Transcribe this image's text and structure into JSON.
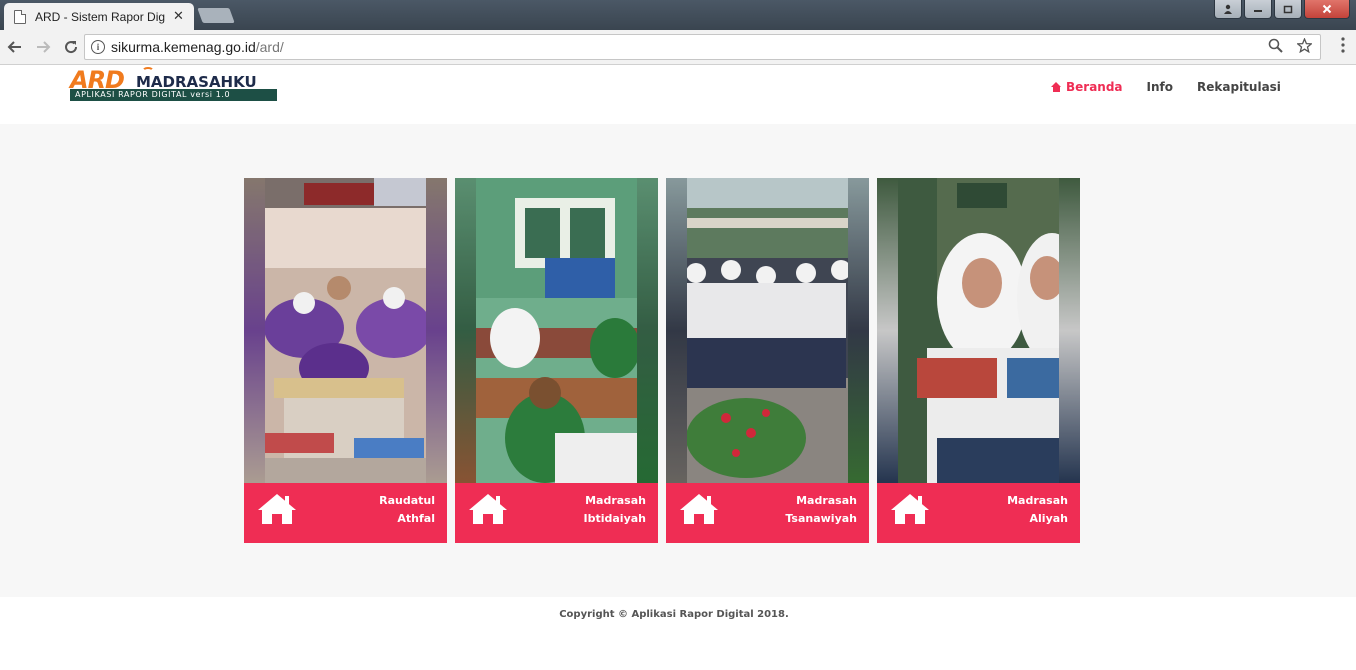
{
  "browser": {
    "tab_title": "ARD - Sistem Rapor Digit",
    "tab_close": "✕",
    "url_host": "sikurma.kemenag.go.id",
    "url_path": "/ard/"
  },
  "header": {
    "logo_ard": "ARD",
    "logo_madrasah": "MADRASAHKU",
    "logo_tagline": "APLIKASI RAPOR DIGITAL versi 1.0",
    "nav": [
      {
        "label": "Beranda",
        "active": true
      },
      {
        "label": "Info"
      },
      {
        "label": "Rekapitulasi"
      }
    ]
  },
  "cards": [
    {
      "line1": "Raudatul",
      "line2": "Athfal",
      "icon": "home-icon"
    },
    {
      "line1": "Madrasah",
      "line2": "Ibtidaiyah",
      "icon": "home-icon"
    },
    {
      "line1": "Madrasah",
      "line2": "Tsanawiyah",
      "icon": "home-icon"
    },
    {
      "line1": "Madrasah",
      "line2": "Aliyah",
      "icon": "home-icon"
    }
  ],
  "footer": {
    "copyright": "Copyright © Aplikasi Rapor Digital 2018."
  },
  "colors": {
    "accent": "#ef2d54",
    "logo_orange": "#f07b1e",
    "logo_green": "#1d4f45"
  }
}
